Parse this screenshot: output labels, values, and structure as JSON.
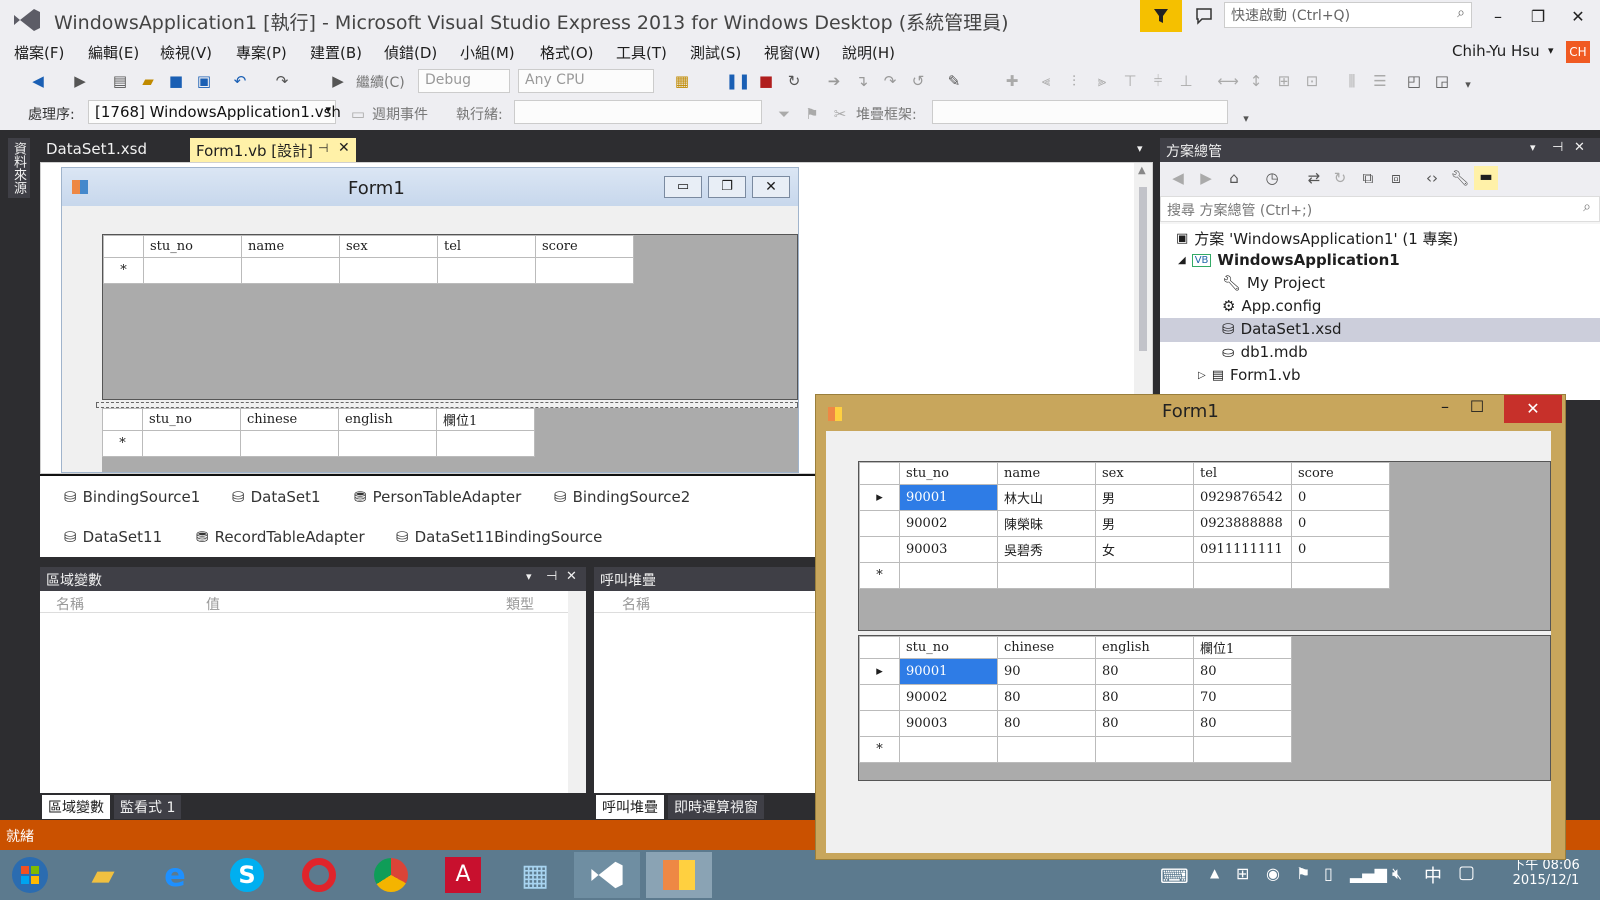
{
  "window": {
    "title": "WindowsApplication1 [執行] - Microsoft Visual Studio Express 2013 for Windows Desktop (系統管理員)",
    "quick_launch_placeholder": "快速啟動 (Ctrl+Q)",
    "user_name": "Chih-Yu Hsu",
    "user_initials": "CH",
    "accent_color": "#ca5100"
  },
  "menu": [
    "檔案(F)",
    "編輯(E)",
    "檢視(V)",
    "專案(P)",
    "建置(B)",
    "偵錯(D)",
    "小組(M)",
    "格式(O)",
    "工具(T)",
    "測試(S)",
    "視窗(W)",
    "說明(H)"
  ],
  "toolbar": {
    "continue_label": "繼續(C)",
    "config": "Debug",
    "platform": "Any CPU",
    "process_label": "處理序:",
    "process_value": "[1768] WindowsApplication1.vsh",
    "lifecycle_label": "週期事件",
    "thread_label": "執行緒:",
    "stack_label": "堆疊框架:"
  },
  "left_strip": {
    "data_sources_tab": "資料來源"
  },
  "doc_tabs": [
    {
      "label": "DataSet1.xsd"
    },
    {
      "label": "Form1.vb [設計]"
    }
  ],
  "designer": {
    "form_title": "Form1",
    "grid1_columns": [
      "stu_no",
      "name",
      "sex",
      "tel",
      "score"
    ],
    "grid2_columns": [
      "stu_no",
      "chinese",
      "english",
      "欄位1"
    ],
    "new_row_marker": "*"
  },
  "tray": [
    "BindingSource1",
    "DataSet1",
    "PersonTableAdapter",
    "BindingSource2",
    "DataSet11",
    "RecordTableAdapter",
    "DataSet11BindingSource"
  ],
  "locals_panel": {
    "title": "區域變數",
    "columns": [
      "名稱",
      "值",
      "類型"
    ],
    "tabs": [
      "區域變數",
      "監看式 1"
    ]
  },
  "callstack_panel": {
    "title": "呼叫堆疊",
    "columns": [
      "名稱"
    ],
    "tabs": [
      "呼叫堆疊",
      "即時運算視窗"
    ]
  },
  "solution_explorer": {
    "title": "方案總管",
    "search_placeholder": "搜尋 方案總管 (Ctrl+;)",
    "items": [
      {
        "label": "方案 'WindowsApplication1' (1 專案)",
        "icon": "solution-icon"
      },
      {
        "label": "WindowsApplication1",
        "icon": "vb-project-icon"
      },
      {
        "label": "My Project",
        "icon": "wrench-icon"
      },
      {
        "label": "App.config",
        "icon": "config-icon"
      },
      {
        "label": "DataSet1.xsd",
        "icon": "dataset-icon"
      },
      {
        "label": "db1.mdb",
        "icon": "database-icon"
      },
      {
        "label": "Form1.vb",
        "icon": "form-icon"
      }
    ]
  },
  "runtime_form": {
    "title": "Form1",
    "grid1": {
      "columns": [
        "stu_no",
        "name",
        "sex",
        "tel",
        "score"
      ],
      "rows": [
        [
          "90001",
          "林大山",
          "男",
          "0929876542",
          "0"
        ],
        [
          "90002",
          "陳榮昧",
          "男",
          "0923888888",
          "0"
        ],
        [
          "90003",
          "吳碧秀",
          "女",
          "0911111111",
          "0"
        ]
      ]
    },
    "grid2": {
      "columns": [
        "stu_no",
        "chinese",
        "english",
        "欄位1"
      ],
      "rows": [
        [
          "90001",
          "90",
          "80",
          "80"
        ],
        [
          "90002",
          "80",
          "80",
          "70"
        ],
        [
          "90003",
          "80",
          "80",
          "80"
        ]
      ]
    },
    "current_row_marker": "▸",
    "new_row_marker": "*"
  },
  "status": {
    "text": "就緒"
  },
  "taskbar": {
    "time": "下午 08:06",
    "date": "2015/12/1",
    "ime": "中"
  }
}
